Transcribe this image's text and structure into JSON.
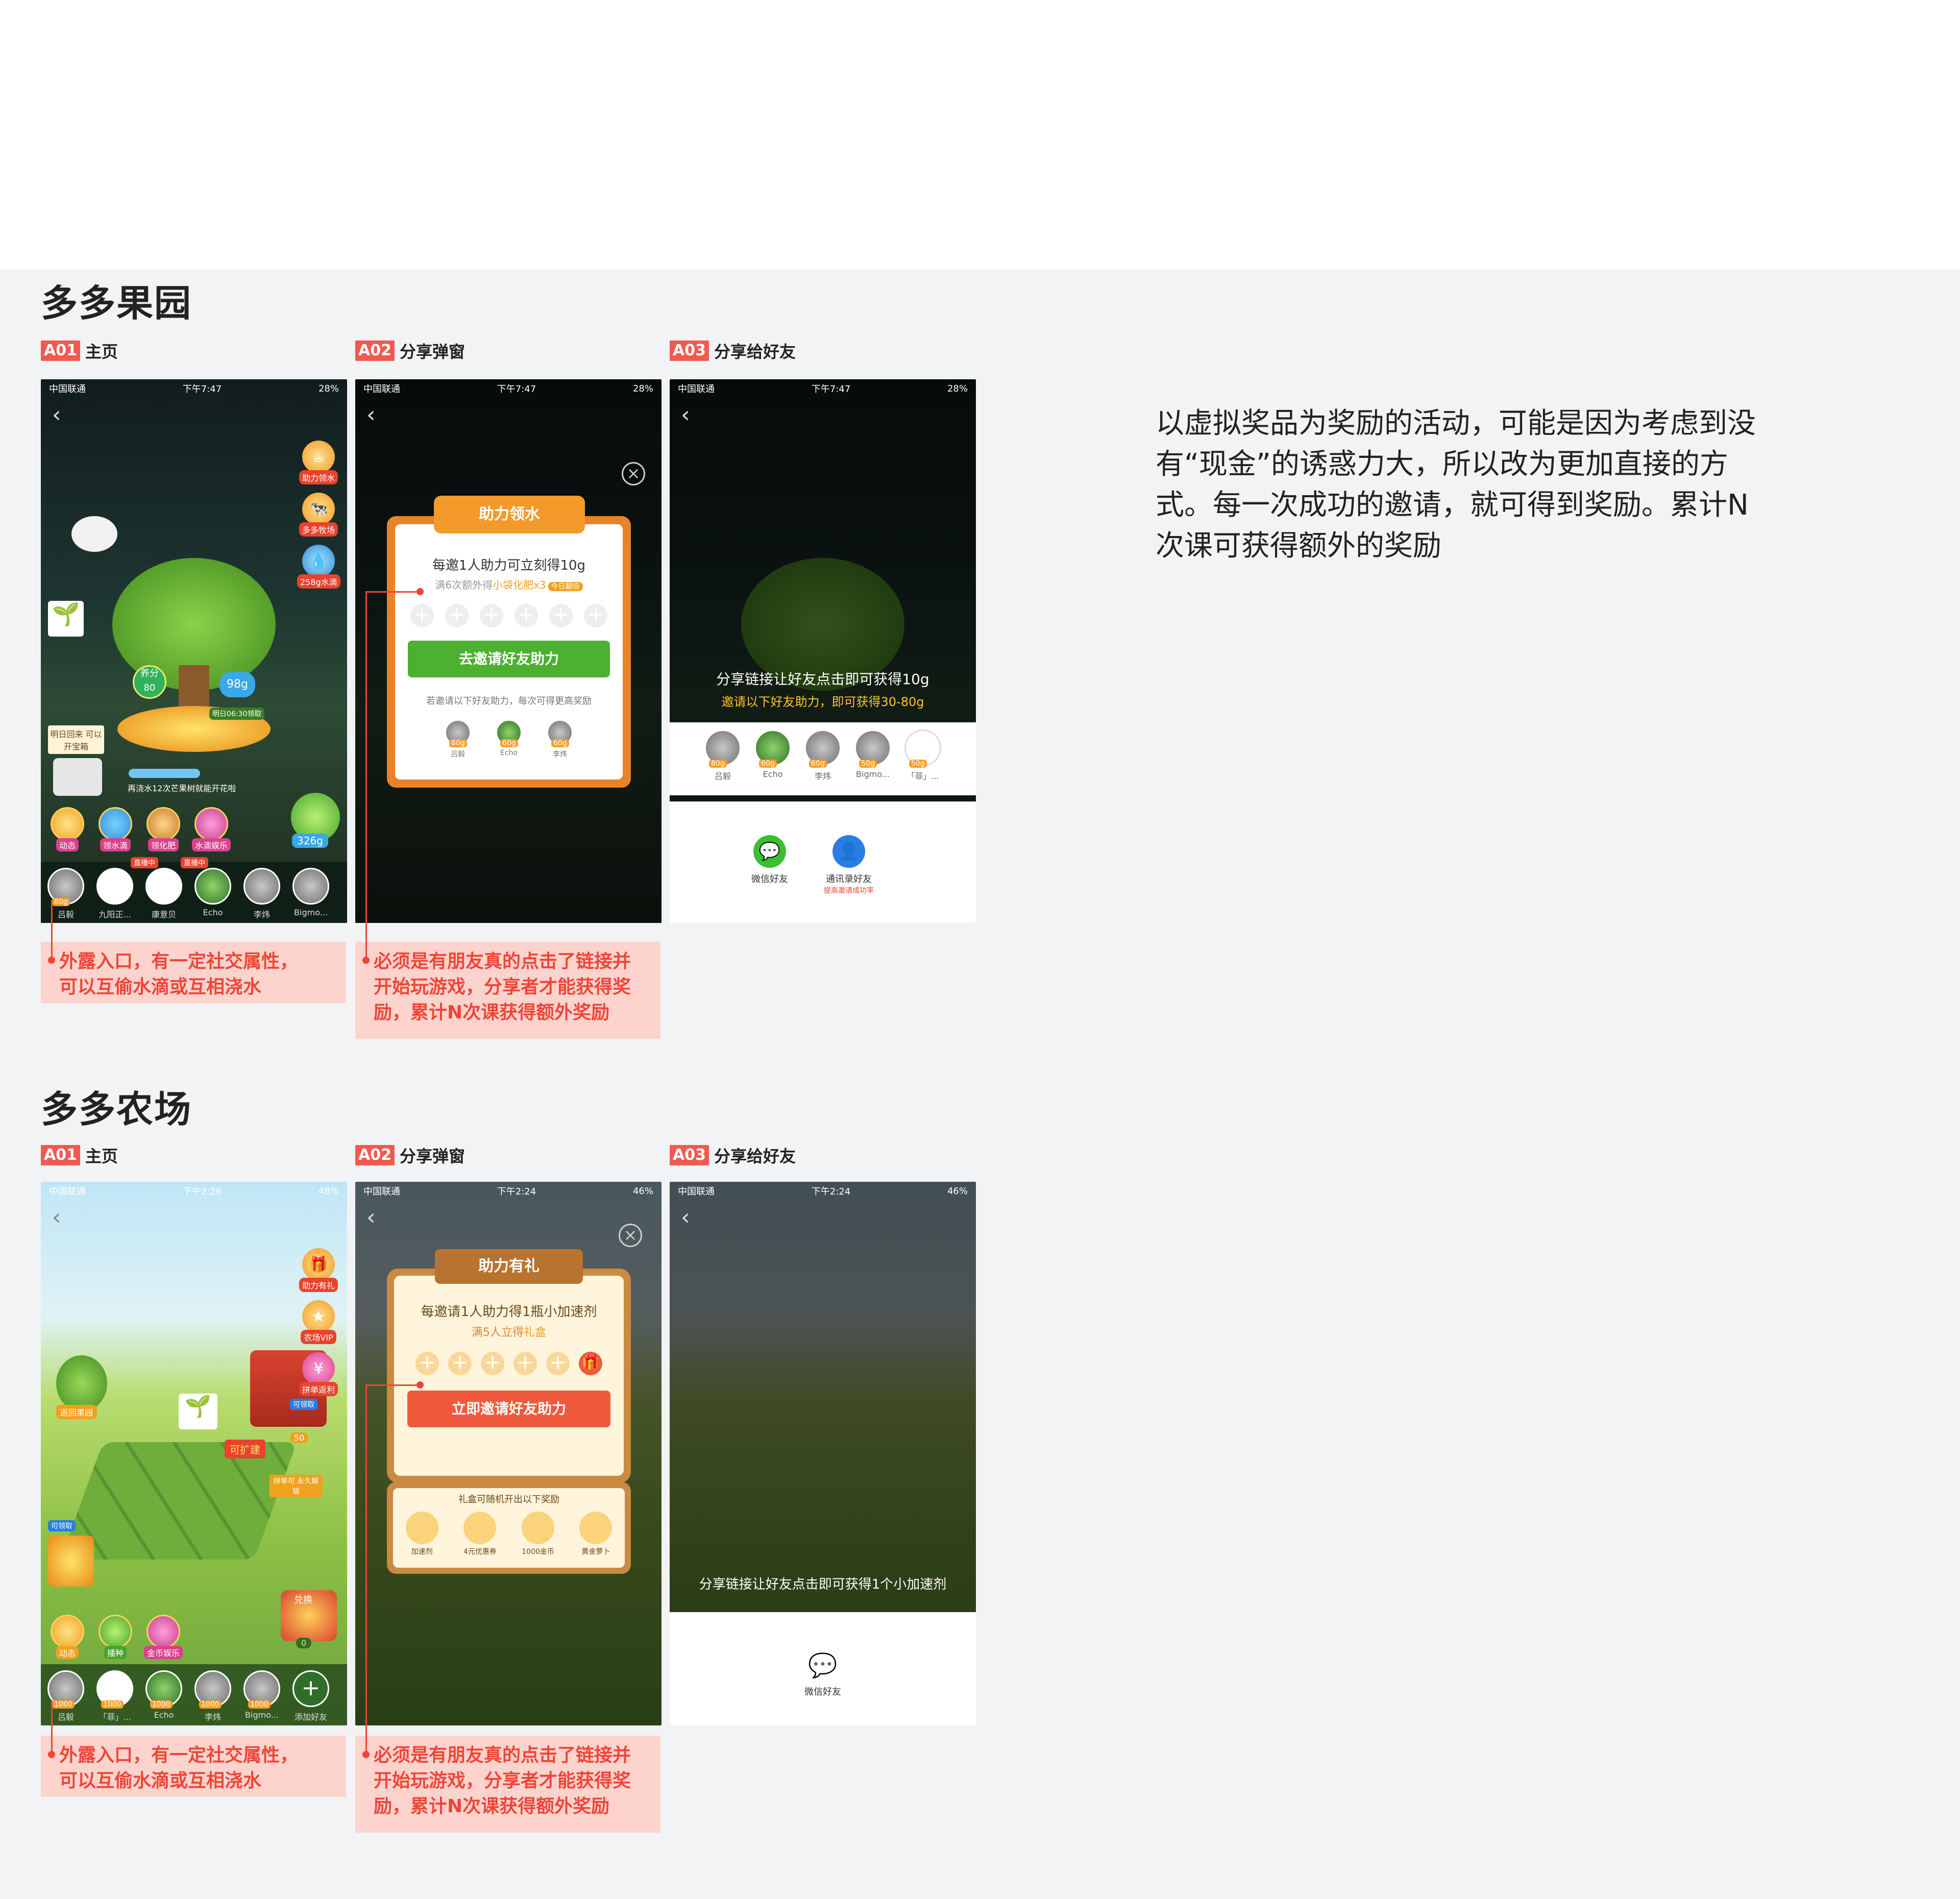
{
  "sections": [
    {
      "title": "多多果园",
      "screens": [
        {
          "tag": "A01",
          "label": "主页",
          "status": {
            "carrier": "中国联通",
            "time": "下午7:47",
            "battery": "28%"
          },
          "side_icons": [
            "助力领水",
            "多多牧场",
            "258g水滴"
          ],
          "tree": {
            "level_label": "养分",
            "level_value": "80",
            "water": "98g",
            "water_note": "明日06:30领取",
            "progress_text": "再浇水12次芒果树就能开花啦"
          },
          "chest_text": "明日回来 可以开宝箱",
          "kettle_value": "326g",
          "actions": [
            "动态",
            "领水滴",
            "领化肥",
            "水滴娱乐"
          ],
          "action_badges": [
            "可领水",
            "免费"
          ],
          "friends": [
            {
              "name": "吕毅",
              "val": "80g"
            },
            {
              "name": "九阳正...",
              "val": "",
              "badge": "直播中"
            },
            {
              "name": "康意贝",
              "val": "",
              "badge": "直播中"
            },
            {
              "name": "Echo",
              "val": ""
            },
            {
              "name": "李炜",
              "val": ""
            },
            {
              "name": "Bigmo...",
              "val": ""
            }
          ]
        },
        {
          "tag": "A02",
          "label": "分享弹窗",
          "status": {
            "carrier": "中国联通",
            "time": "下午7:47",
            "battery": "28%"
          },
          "popup": {
            "title": "助力领水",
            "headline": "每邀1人助力可立刻得10g",
            "subline_prefix": "满6次额外得",
            "subline_item": "小袋化肥x3",
            "subline_badge": "今日翻倍",
            "button": "去邀请好友助力",
            "hint": "若邀请以下好友助力，每次可得更高奖励",
            "friends": [
              {
                "name": "吕毅",
                "val": "80g"
              },
              {
                "name": "Echo",
                "val": "60g"
              },
              {
                "name": "李炜",
                "val": "60g"
              }
            ]
          }
        },
        {
          "tag": "A03",
          "label": "分享给好友",
          "status": {
            "carrier": "中国联通",
            "time": "下午7:47",
            "battery": "28%"
          },
          "share_line1": "分享链接让好友点击即可获得10g",
          "share_line2": "邀请以下好友助力，即可获得30-80g",
          "friends": [
            {
              "name": "吕毅",
              "val": "80g"
            },
            {
              "name": "Echo",
              "val": "60g"
            },
            {
              "name": "李炜",
              "val": "60g"
            },
            {
              "name": "Bigmo...",
              "val": "50g"
            },
            {
              "name": "「菲」...",
              "val": "50g"
            }
          ],
          "targets": [
            {
              "name": "微信好友",
              "sub": ""
            },
            {
              "name": "通讯录好友",
              "sub": "提高邀请成功率"
            }
          ]
        }
      ],
      "notes": [
        "外露入口，有一定社交属性，\n可以互偷水滴或互相浇水",
        "必须是有朋友真的点击了链接并\n开始玩游戏，分享者才能获得奖\n励，累计N次课获得额外奖励"
      ]
    },
    {
      "title": "多多农场",
      "screens": [
        {
          "tag": "A01",
          "label": "主页",
          "status": {
            "carrier": "中国联通",
            "time": "下午2:26",
            "battery": "48%"
          },
          "side_icons": [
            "助力有礼",
            "农场VIP",
            "拼单返利"
          ],
          "farm": {
            "back_orchard": "返回果园",
            "expand": "可扩建",
            "unlock": "拼单可 永久解锁",
            "claim": "可领取",
            "claim2": "可领取",
            "coins": "50",
            "exchange": "兑换",
            "coin_count": "0"
          },
          "actions": [
            "动态",
            "播种",
            "金币娱乐"
          ],
          "friends": [
            {
              "name": "吕毅",
              "val": "1000"
            },
            {
              "name": "「菲」...",
              "val": "1000"
            },
            {
              "name": "Echo",
              "val": "1000"
            },
            {
              "name": "李炜",
              "val": "1000"
            },
            {
              "name": "Bigmo...",
              "val": "1000"
            }
          ],
          "add_friend": "添加好友"
        },
        {
          "tag": "A02",
          "label": "分享弹窗",
          "status": {
            "carrier": "中国联通",
            "time": "下午2:24",
            "battery": "46%"
          },
          "popup": {
            "title": "助力有礼",
            "headline": "每邀请1人助力得1瓶小加速剂",
            "subline_prefix": "满5人立得",
            "subline_item": "礼盒",
            "button": "立即邀请好友助力",
            "gift_title": "礼盒可随机开出以下奖励",
            "gifts": [
              "加速剂",
              "4元优惠券",
              "1000金币",
              "黄金萝卜"
            ]
          }
        },
        {
          "tag": "A03",
          "label": "分享给好友",
          "status": {
            "carrier": "中国联通",
            "time": "下午2:24",
            "battery": "46%"
          },
          "share_line1": "分享链接让好友点击即可获得1个小加速剂",
          "targets": [
            {
              "name": "微信好友"
            }
          ]
        }
      ],
      "notes": [
        "外露入口，有一定社交属性，\n可以互偷水滴或互相浇水",
        "必须是有朋友真的点击了链接并\n开始玩游戏，分享者才能获得奖\n励，累计N次课获得额外奖励"
      ]
    }
  ],
  "description": "以虚拟奖品为奖励的活动，可能是因为考虑到没有“现金”的诱惑力大，所以改为更加直接的方式。每一次成功的邀请，就可得到奖励。累计N次课可获得额外的奖励",
  "colors": {
    "accent_red": "#ee4537",
    "tag_red": "#f05a51",
    "note_bg": "#fcd3cd",
    "green_btn": "#4cb031",
    "orange_btn": "#f05a3c",
    "wechat_green": "#3bbf30"
  }
}
